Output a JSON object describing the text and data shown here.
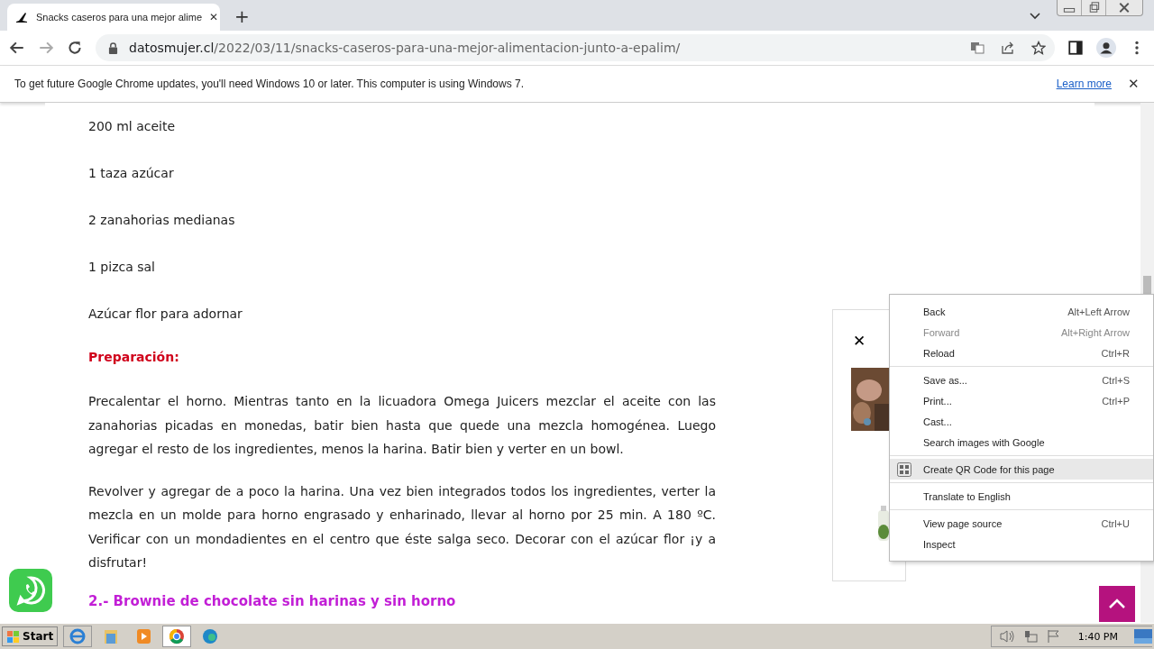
{
  "tab": {
    "title": "Snacks caseros para una mejor alime",
    "close": "✕",
    "new": "+"
  },
  "address": {
    "domain": "datosmujer.cl",
    "path": "/2022/03/11/snacks-caseros-para-una-mejor-alimentacion-junto-a-epalim/"
  },
  "infobar": {
    "message": "To get future Google Chrome updates, you'll need Windows 10 or later. This computer is using Windows 7.",
    "link": "Learn more",
    "close": "✕"
  },
  "article": [
    {
      "kind": "text",
      "text": "200 ml aceite"
    },
    {
      "kind": "text",
      "text": "1 taza azúcar"
    },
    {
      "kind": "text",
      "text": "2 zanahorias medianas"
    },
    {
      "kind": "text",
      "text": "1 pizca sal"
    },
    {
      "kind": "text",
      "text": "Azúcar flor para adornar"
    },
    {
      "kind": "heading",
      "text": "Preparación:"
    },
    {
      "kind": "paragraph",
      "text": "Precalentar el horno. Mientras tanto en la licuadora Omega Juicers mezclar el aceite con las zanahorias picadas en monedas, batir bien hasta que quede una mezcla homogénea. Luego agregar el resto de los ingredientes, menos la harina. Batir bien y verter en un bowl."
    },
    {
      "kind": "paragraph",
      "text": "Revolver y agregar de a poco la harina. Una vez bien integrados todos los ingredientes, verter la mezcla en un molde para horno engrasado y enharinado, llevar al horno por 25 min. A 180 ºC. Verificar con un mondadientes en el centro que éste salga seco. Decorar con el azúcar flor ¡y a disfrutar!"
    },
    {
      "kind": "subtitle",
      "text": "2.- Brownie de chocolate sin harinas y sin horno"
    }
  ],
  "popup": {
    "close": "✕"
  },
  "menu": {
    "groups": [
      {
        "items": [
          {
            "label": "Back",
            "shortcut": "Alt+Left Arrow",
            "disabled": false,
            "selected": false
          },
          {
            "label": "Forward",
            "shortcut": "Alt+Right Arrow",
            "disabled": true,
            "selected": false
          },
          {
            "label": "Reload",
            "shortcut": "Ctrl+R",
            "disabled": false,
            "selected": false
          }
        ]
      },
      {
        "items": [
          {
            "label": "Save as...",
            "shortcut": "Ctrl+S",
            "disabled": false,
            "selected": false
          },
          {
            "label": "Print...",
            "shortcut": "Ctrl+P",
            "disabled": false,
            "selected": false
          },
          {
            "label": "Cast...",
            "disabled": false,
            "selected": false
          },
          {
            "label": "Search images with Google",
            "disabled": false,
            "selected": false
          }
        ]
      },
      {
        "items": [
          {
            "label": "Create QR Code for this page",
            "kind": "qr",
            "disabled": false,
            "selected": true
          }
        ]
      },
      {
        "items": [
          {
            "label": "Translate to English",
            "disabled": false,
            "selected": false
          }
        ]
      },
      {
        "items": [
          {
            "label": "View page source",
            "shortcut": "Ctrl+U",
            "disabled": false,
            "selected": false
          },
          {
            "label": "Inspect",
            "disabled": false,
            "selected": false
          }
        ]
      }
    ]
  },
  "taskbar": {
    "start": "Start",
    "clock": "1:40 PM"
  }
}
